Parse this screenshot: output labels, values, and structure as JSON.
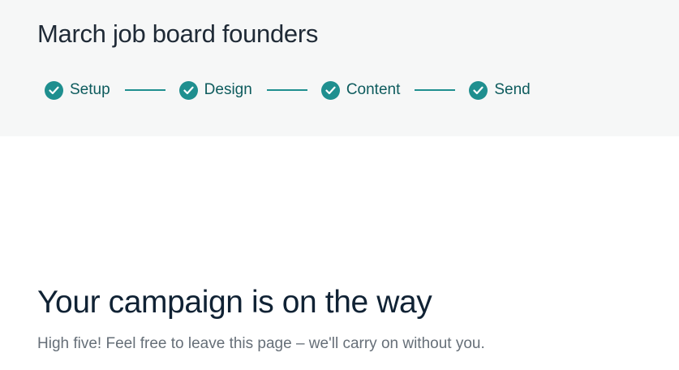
{
  "campaign": {
    "title": "March job board founders"
  },
  "steps": [
    {
      "label": "Setup",
      "status": "complete",
      "icon": "check-circle-icon"
    },
    {
      "label": "Design",
      "status": "complete",
      "icon": "check-circle-icon"
    },
    {
      "label": "Content",
      "status": "complete",
      "icon": "check-circle-icon"
    },
    {
      "label": "Send",
      "status": "complete",
      "icon": "check-circle-icon"
    }
  ],
  "confirmation": {
    "headline": "Your campaign is on the way",
    "message": "High five! Feel free to leave this page – we'll carry on without you."
  },
  "colors": {
    "accent": "#1f8f8f",
    "step_text": "#0d5b5d",
    "header_background": "#f6f7f7",
    "title_text": "#1f2a36",
    "headline_text": "#102234",
    "body_text": "#666f78"
  }
}
